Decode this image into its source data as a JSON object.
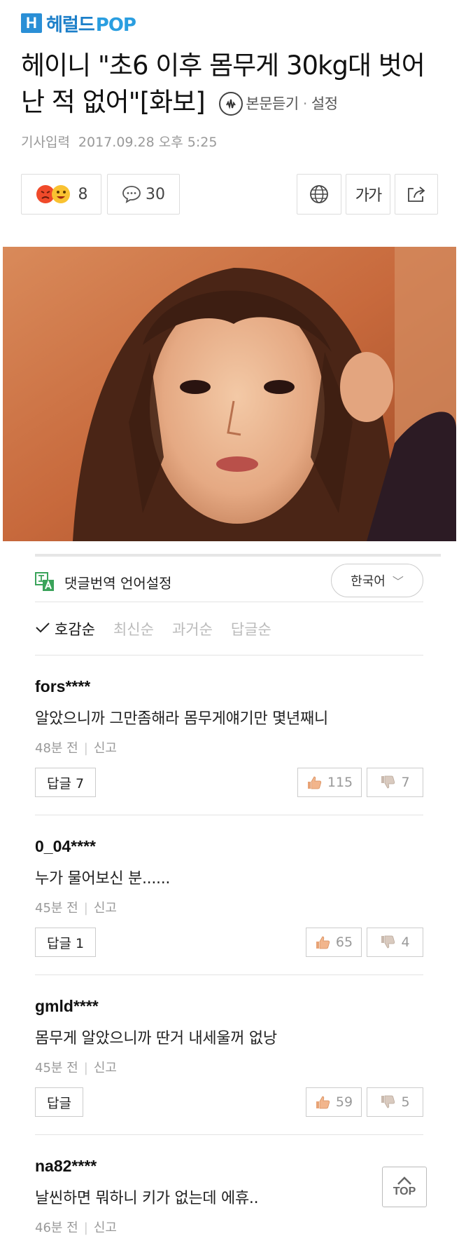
{
  "header": {
    "logo_mark": "H",
    "logo_name": "헤럴드",
    "logo_pop": "POP"
  },
  "article": {
    "title": "헤이니 \"초6 이후 몸무게 30kg대 벗어난 적 없어\"[화보]",
    "listen_label": "본문듣기",
    "separator": "·",
    "settings_label": "설정",
    "input_label": "기사입력",
    "date": "2017.09.28 오후 5:25"
  },
  "toolbar": {
    "reaction_count": "8",
    "comment_count": "30",
    "font_label": "가가"
  },
  "comments_section": {
    "translate_label": "댓글번역 언어설정",
    "language": "한국어",
    "sort_options": [
      "호감순",
      "최신순",
      "과거순",
      "답글순"
    ],
    "report_label": "신고",
    "top_label": "TOP",
    "items": [
      {
        "user": "fors****",
        "text": "알았으니까 그만좀해라 몸무게얘기만 몇년째니",
        "time": "48분 전",
        "reply": "답글 7",
        "likes": "115",
        "dislikes": "7"
      },
      {
        "user": "0_04****",
        "text": "누가 물어보신 분......",
        "time": "45분 전",
        "reply": "답글 1",
        "likes": "65",
        "dislikes": "4"
      },
      {
        "user": "gmld****",
        "text": "몸무게 알았으니까 딴거 내세울꺼 없낭",
        "time": "45분 전",
        "reply": "답글",
        "likes": "59",
        "dislikes": "5"
      },
      {
        "user": "na82****",
        "text": "날씬하면 뭐하니 키가 없는데 에휴..",
        "time": "46분 전"
      }
    ]
  },
  "colors": {
    "brand": "#1c7fc9",
    "muted": "#999999",
    "photo_bg": "#c9703f"
  }
}
